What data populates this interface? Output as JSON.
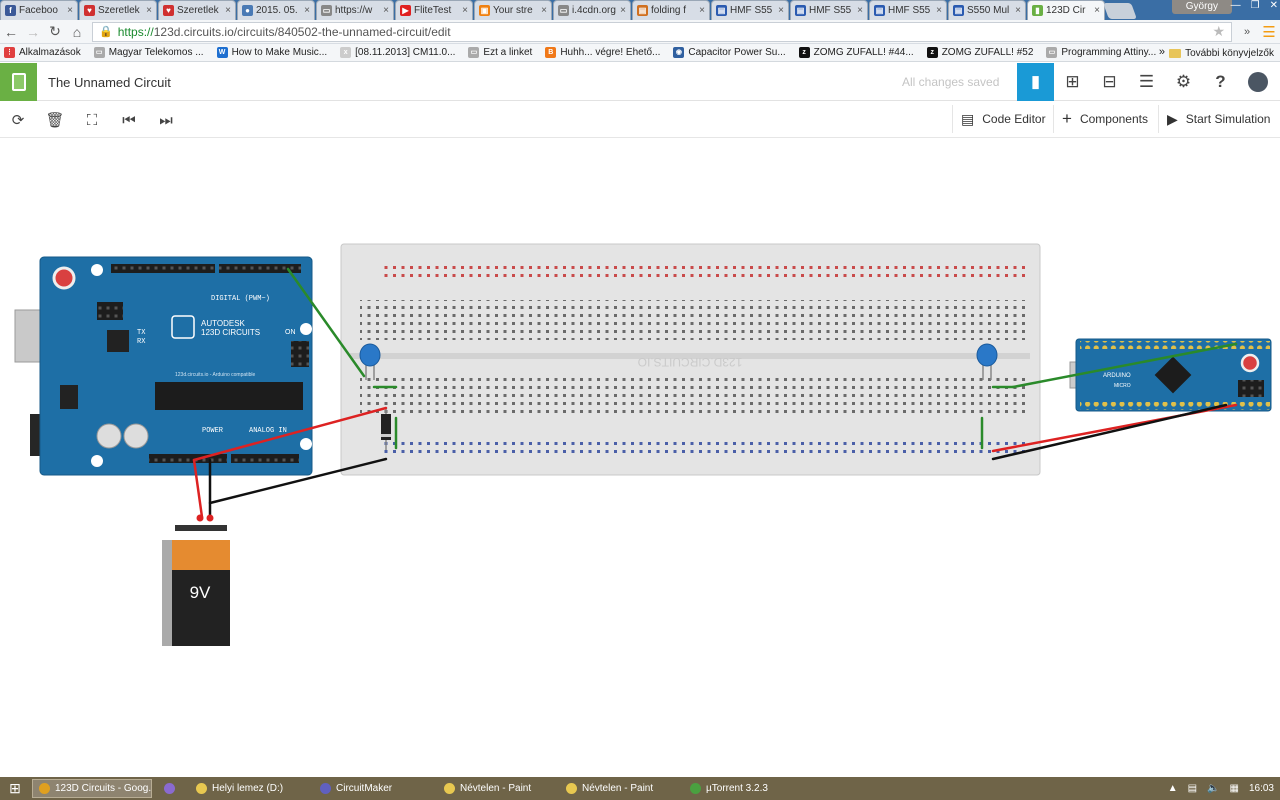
{
  "browser": {
    "tabs": [
      {
        "label": "Faceboo",
        "fav_color": "#3b5998",
        "fav_glyph": "f"
      },
      {
        "label": "Szeretlek",
        "fav_color": "#d03030",
        "fav_glyph": "♥"
      },
      {
        "label": "Szeretlek",
        "fav_color": "#d03030",
        "fav_glyph": "♥"
      },
      {
        "label": "2015. 05.",
        "fav_color": "#4a7ab5",
        "fav_glyph": "●"
      },
      {
        "label": "https://w",
        "fav_color": "#888888",
        "fav_glyph": "▭"
      },
      {
        "label": "FliteTest",
        "fav_color": "#e02020",
        "fav_glyph": "▶"
      },
      {
        "label": "Your stre",
        "fav_color": "#f08010",
        "fav_glyph": "▣"
      },
      {
        "label": "i.4cdn.org",
        "fav_color": "#888888",
        "fav_glyph": "▭"
      },
      {
        "label": "folding f",
        "fav_color": "#d07020",
        "fav_glyph": "▤"
      },
      {
        "label": "HMF S55",
        "fav_color": "#2a5ab0",
        "fav_glyph": "▤"
      },
      {
        "label": "HMF S55",
        "fav_color": "#2a5ab0",
        "fav_glyph": "▤"
      },
      {
        "label": "HMF S55",
        "fav_color": "#2a5ab0",
        "fav_glyph": "▤"
      },
      {
        "label": "S550 Mul",
        "fav_color": "#2a5ab0",
        "fav_glyph": "▤"
      },
      {
        "label": "123D Cir",
        "fav_color": "#6ab044",
        "fav_glyph": "▮",
        "active": true
      }
    ],
    "user": "György",
    "url_https": "https://",
    "url_rest": "123d.circuits.io/circuits/840502-the-unnamed-circuit/edit",
    "bookmarks": [
      {
        "label": "Alkalmazások",
        "color": "#e04040",
        "glyph": "⋮"
      },
      {
        "label": "Magyar Telekomos ...",
        "color": "#aaaaaa",
        "glyph": "▭"
      },
      {
        "label": "How to Make Music...",
        "color": "#1e6fd0",
        "glyph": "W"
      },
      {
        "label": "[08.11.2013] CM11.0...",
        "color": "#cccccc",
        "glyph": "x"
      },
      {
        "label": "Ezt a linket",
        "color": "#aaaaaa",
        "glyph": "▭"
      },
      {
        "label": "Huhh... végre! Ehető...",
        "color": "#f07818",
        "glyph": "B"
      },
      {
        "label": "Capacitor Power Su...",
        "color": "#3060a0",
        "glyph": "◉"
      },
      {
        "label": "ZOMG ZUFALL! #44...",
        "color": "#111111",
        "glyph": "z"
      },
      {
        "label": "ZOMG ZUFALL! #52",
        "color": "#111111",
        "glyph": "z"
      },
      {
        "label": "Programming Attiny...",
        "color": "#aaaaaa",
        "glyph": "▭"
      }
    ],
    "bookmarks_more": "»",
    "other_bookmarks": "További könyvjelzők"
  },
  "app": {
    "title": "The Unnamed Circuit",
    "save_status": "All changes saved",
    "toolbar": {
      "code_editor": "Code Editor",
      "components": "Components",
      "start_simulation": "Start Simulation"
    }
  },
  "circuit": {
    "uno_brand_top": "AUTODESK",
    "uno_brand": "123D CIRCUITS",
    "uno_on": "ON",
    "uno_digital": "DIGITAL (PWM~)",
    "uno_power": "POWER",
    "uno_analog": "ANALOG IN",
    "uno_tx": "TX",
    "uno_rx": "RX",
    "uno_footer": "123d.circuits.io - Arduino compatible",
    "breadboard_logo": "123D.CIRCUITS.IO",
    "battery_label": "9V",
    "micro_brand": "ARDUINO",
    "micro_model": "MICRO"
  },
  "taskbar": {
    "items": [
      {
        "label": "123D Circuits - Goog...",
        "color": "#e0a020",
        "active": true
      },
      {
        "label": "",
        "color": "#8a6ad0"
      },
      {
        "label": "Helyi lemez (D:)",
        "color": "#e8c850"
      },
      {
        "label": "CircuitMaker",
        "color": "#6060c0"
      },
      {
        "label": "Névtelen - Paint",
        "color": "#e8c850"
      },
      {
        "label": "Névtelen - Paint",
        "color": "#e8c850"
      },
      {
        "label": "µTorrent 3.2.3",
        "color": "#4aa040"
      }
    ],
    "clock": "16:03"
  }
}
